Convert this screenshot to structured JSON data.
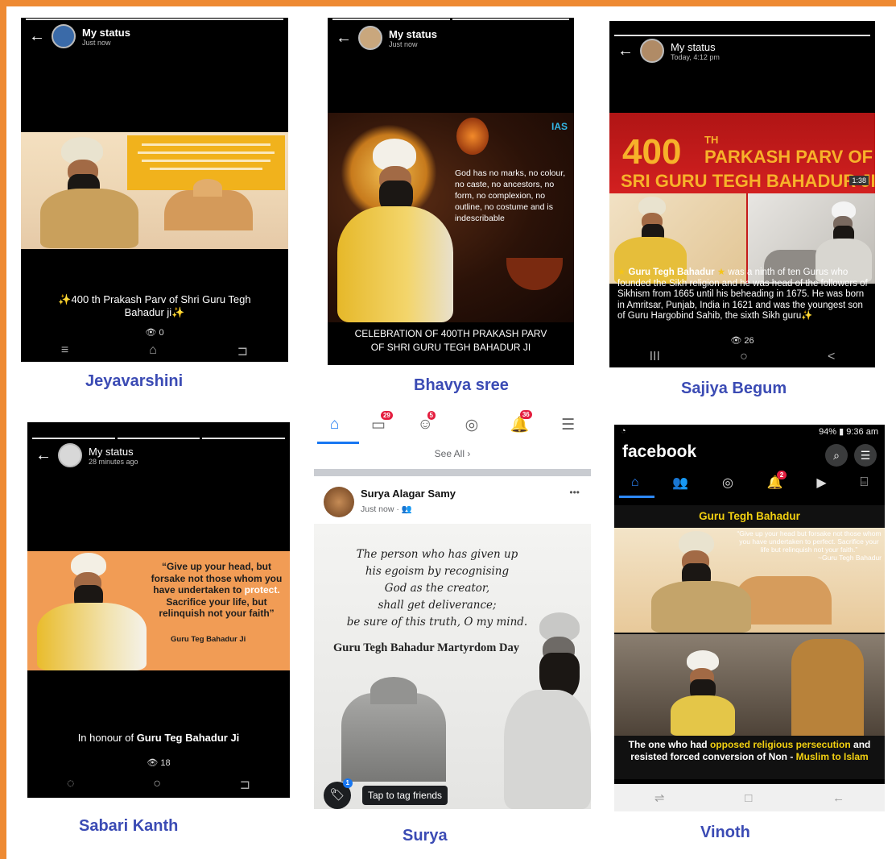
{
  "captions": [
    "Jeyavarshini",
    "Bhavya sree",
    "Sajiya Begum",
    "Sabari Kanth",
    "Surya",
    "Vinoth"
  ],
  "p1": {
    "title": "My status",
    "time": "Just now",
    "caption": "✨400 th Prakash Parv of Shri Guru Tegh Bahadur ji✨",
    "views": "0",
    "nav": [
      "≡",
      "⌂",
      "⊐"
    ]
  },
  "p2": {
    "title": "My status",
    "time": "Just now",
    "logo": "IAS",
    "quote": "God has no marks, no colour, no caste, no ancestors, no form, no complexion, no outline, no costume and is indescribable",
    "bottom": "CELEBRATION OF 400TH PRAKASH PARV OF SHRI GURU TEGH BAHADUR JI"
  },
  "p3": {
    "title": "My status",
    "time": "Today, 4:12 pm",
    "banner_num": "400",
    "banner_th": "TH",
    "banner_l1": "PARKASH PARV OF",
    "banner_l2": "SRI GURU TEGH BAHADUR JI",
    "clock": "1:38",
    "text_bold": "Guru Tegh Bahadur",
    "text_rest": "was a ninth of ten Gurus who founded the Sikh religion and he was head of the followers of Sikhism from 1665 until his beheading in 1675. He was born in Amritsar, Punjab, India in 1621 and was the youngest son of Guru Hargobind Sahib, the sixth Sikh guru✨",
    "views": "26",
    "nav": [
      "III",
      "○",
      "<"
    ]
  },
  "p4": {
    "title": "My status",
    "time": "28 minutes ago",
    "quote_a": "“Give up your head, but forsake not those whom you have undertaken to ",
    "quote_b": "protect.",
    "quote_c": " Sacrifice your life, but relinquish not your faith”",
    "attribution": "Guru Teg Bahadur Ji",
    "caption_a": "In honour of ",
    "caption_b": "Guru Teg Bahadur Ji",
    "views": "18",
    "nav": [
      "◌",
      "○",
      "⊐"
    ]
  },
  "p5": {
    "badges": [
      "29",
      "5",
      "36"
    ],
    "see_all": "See All",
    "name": "Surya Alagar Samy",
    "time": "Just now · 👥",
    "more": "•••",
    "quote": [
      "The person who has given up",
      "his egoism by recognising",
      "God as the creator,",
      "shall get deliverance;",
      "be sure of this truth, O my mind."
    ],
    "martyrdom": "Guru Tegh Bahadur Martyrdom Day",
    "tag_badge": "1",
    "tag_text": "Tap to tag friends"
  },
  "p6": {
    "status_right": "94% ▮ 9:36 am",
    "logo": "facebook",
    "badge": "2",
    "title": "Guru Tegh Bahadur",
    "quote": "“Give up your head but forsake not those whom you have undertaken to perfect. Sacrifice your life but relinquish not your faith.”",
    "attribution": "~Guru Tegh Bahadur",
    "bottom_a": "The one who had ",
    "bottom_b": "opposed religious persecution",
    "bottom_c": " and resisted forced conversion of Non - ",
    "bottom_d": "Muslim to Islam",
    "nav": [
      "⇌",
      "□",
      "←"
    ]
  },
  "colors": {
    "frame": "#ee8a33",
    "caption": "#3b4bb4",
    "fb_blue": "#1877f2",
    "banner_red": "#b01515"
  }
}
